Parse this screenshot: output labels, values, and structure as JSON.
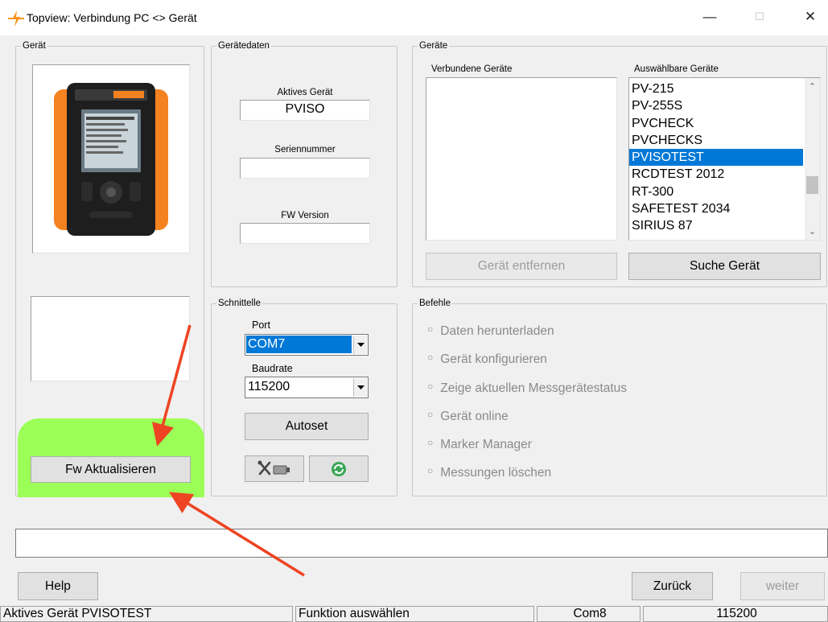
{
  "window": {
    "title": "Topview: Verbindung  PC <> Gerät",
    "minimize": "—",
    "maximize": "☐",
    "close": "✕"
  },
  "geraet_group": {
    "label": "Gerät",
    "fw_button": "Fw Aktualisieren"
  },
  "geraetedaten": {
    "label": "Gerätedaten",
    "active_label": "Aktives Gerät",
    "active_value": "PVISO",
    "serial_label": "Seriennummer",
    "serial_value": "",
    "fw_label": "FW Version",
    "fw_value": ""
  },
  "geraete": {
    "label": "Geräte",
    "connected_label": "Verbundene Geräte",
    "selectable_label": "Auswählbare Geräte",
    "selectable_items": [
      "PV-215",
      "PV-255S",
      "PVCHECK",
      "PVCHECKS",
      "PVISOTEST",
      "RCDTEST 2012",
      "RT-300",
      "SAFETEST 2034",
      "SIRIUS 87"
    ],
    "selected_index": 4,
    "remove_button": "Gerät entfernen",
    "search_button": "Suche Gerät"
  },
  "schnittstelle": {
    "label": "Schnittelle",
    "port_label": "Port",
    "port_value": "COM7",
    "baud_label": "Baudrate",
    "baud_value": "115200",
    "autoset_button": "Autoset"
  },
  "befehle": {
    "label": "Befehle",
    "options": [
      "Daten herunterladen",
      "Gerät konfigurieren",
      "Zeige aktuellen Messgerätestatus",
      "Gerät online",
      "Marker Manager",
      "Messungen löschen"
    ]
  },
  "bottom": {
    "help": "Help",
    "back": "Zurück",
    "next": "weiter"
  },
  "statusbar": {
    "device": "Aktives Gerät PVISOTEST",
    "function": "Funktion auswählen",
    "com": "Com8",
    "baud": "115200"
  },
  "colors": {
    "highlight": "#9cff57",
    "arrow": "#ee4422",
    "selection": "#0078d7",
    "accent_icon": "#f7941d"
  }
}
